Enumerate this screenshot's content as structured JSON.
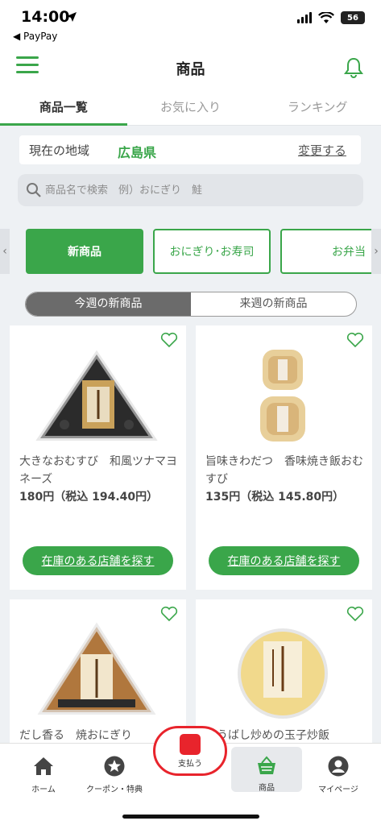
{
  "status_bar": {
    "time": "14:00",
    "back_app": "◀ PayPay",
    "battery": "56"
  },
  "header": {
    "title": "商品"
  },
  "tabs": [
    {
      "label": "商品一覧"
    },
    {
      "label": "お気に入り"
    },
    {
      "label": "ランキング"
    }
  ],
  "region": {
    "label": "現在の地域",
    "value": "広島県",
    "change_link": "変更する"
  },
  "search": {
    "placeholder": "商品名で検索　例）おにぎり　鮭"
  },
  "categories": {
    "items": [
      {
        "label": "新商品"
      },
      {
        "label": "おにぎり･お寿司"
      },
      {
        "label": "お弁当"
      }
    ]
  },
  "week_toggle": {
    "this_week": "今週の新商品",
    "next_week": "来週の新商品"
  },
  "products": [
    {
      "name": "大きなおむすび　和風ツナマヨネーズ",
      "price": "180円（税込 194.40円）",
      "button": "在庫のある店舗を探す"
    },
    {
      "name": "旨味きわだつ　香味焼き飯おむすび",
      "price": "135円（税込 145.80円）",
      "button": "在庫のある店舗を探す"
    },
    {
      "name": "だし香る　焼おにぎり"
    },
    {
      "name": "こうばし炒めの玉子炒飯"
    }
  ],
  "bottom_nav": {
    "home": "ホーム",
    "coupon": "クーポン・特典",
    "pay": "支払う",
    "products": "商品",
    "mypage": "マイページ"
  },
  "colors": {
    "brand_green": "#3aa64a",
    "pay_red": "#e8242c"
  }
}
